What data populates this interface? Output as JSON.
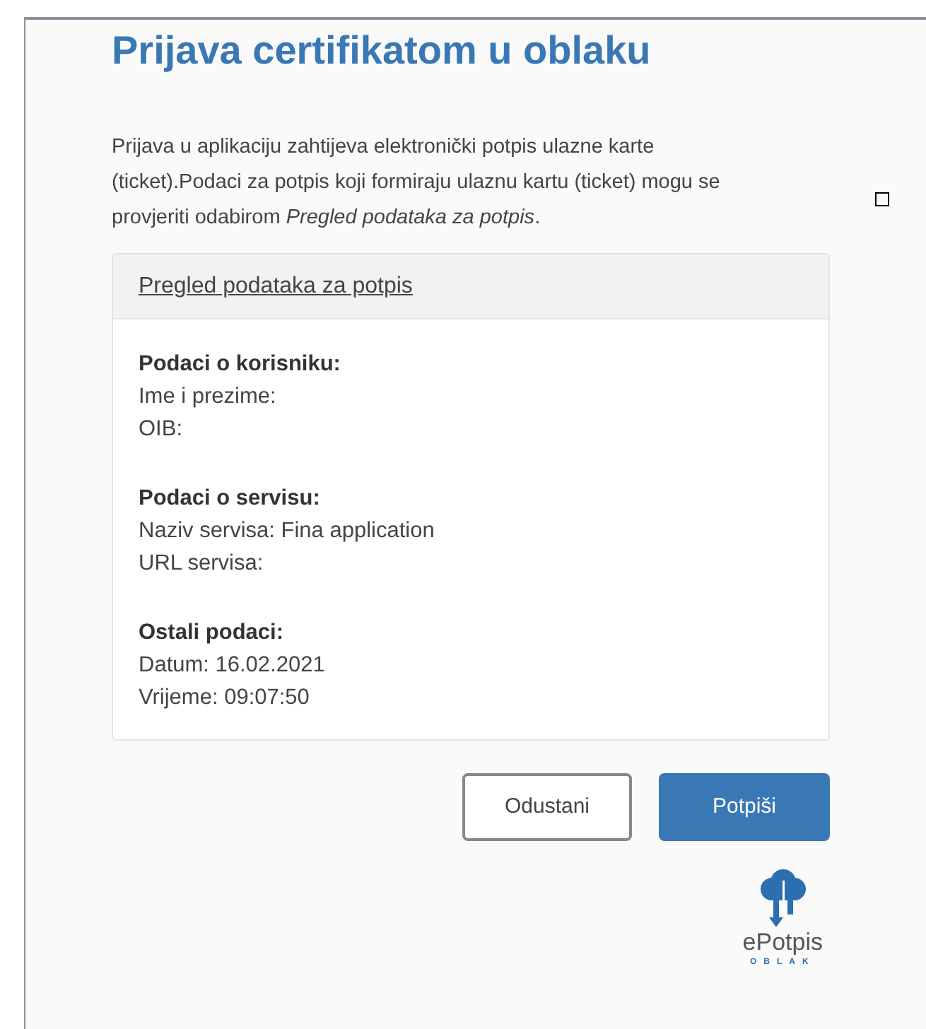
{
  "title": "Prijava certifikatom u oblaku",
  "intro": "Prijava u aplikaciju zahtijeva elektronički potpis ulazne karte (ticket).Podaci za potpis koji formiraju ulaznu kartu (ticket) mogu se provjeriti odabirom *Pregled podataka za potpis*.",
  "panel": {
    "link": "Pregled podataka za potpis",
    "sections": [
      {
        "heading": "Podaci o korisniku:",
        "lines": [
          "Ime i prezime:",
          "OIB:"
        ]
      },
      {
        "heading": "Podaci o servisu:",
        "lines": [
          "Naziv servisa: Fina application",
          "URL servisa:"
        ]
      },
      {
        "heading": "Ostali podaci:",
        "lines": [
          "Datum: 16.02.2021",
          "Vrijeme: 09:07:50"
        ]
      }
    ]
  },
  "buttons": [
    {
      "label": "Odustani",
      "kind": "secondary"
    },
    {
      "label": "Potpiši",
      "kind": "primary"
    }
  ],
  "logo": {
    "name": "ePotpis",
    "tagline": "OBLAK"
  }
}
